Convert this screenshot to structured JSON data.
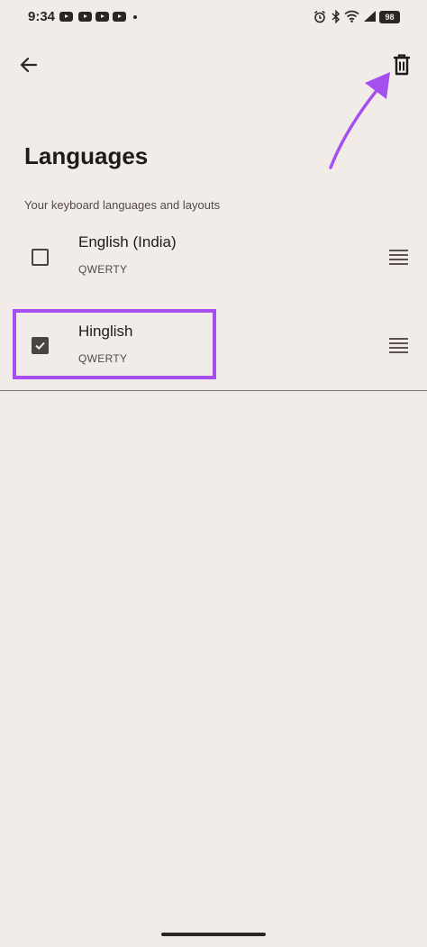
{
  "status_bar": {
    "time": "9:34",
    "battery": "98",
    "icons": [
      "youtube-icon",
      "youtube-icon",
      "youtube-icon",
      "youtube-icon",
      "notification-dot-icon",
      "alarm-icon",
      "bluetooth-icon",
      "wifi-icon",
      "battery-icon"
    ]
  },
  "toolbar": {
    "back_icon": "arrow-back-icon",
    "delete_icon": "trash-icon"
  },
  "page": {
    "title": "Languages",
    "subtitle": "Your keyboard languages and layouts"
  },
  "languages": [
    {
      "name": "English (India)",
      "layout": "QWERTY",
      "checked": false
    },
    {
      "name": "Hinglish",
      "layout": "QWERTY",
      "checked": true
    }
  ],
  "colors": {
    "background": "#f2ece9",
    "annotation": "#a64ff0",
    "text_primary": "#1f1b1a",
    "text_secondary": "#514a48"
  }
}
